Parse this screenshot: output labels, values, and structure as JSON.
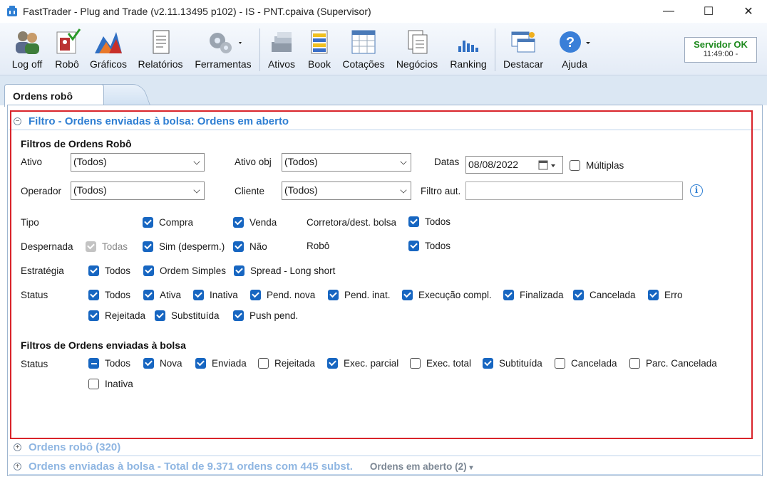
{
  "window": {
    "title": "FastTrader - Plug and Trade (v2.11.13495 p102) - IS - PNT.cpaiva (Supervisor)",
    "minimize": "—",
    "maximize": "☐",
    "close": "✕"
  },
  "toolbar": {
    "items": [
      {
        "label": "Log off",
        "icon": "users-icon"
      },
      {
        "label": "Robô",
        "icon": "robot-icon"
      },
      {
        "label": "Gráficos",
        "icon": "chart-icon"
      },
      {
        "label": "Relatórios",
        "icon": "report-icon"
      },
      {
        "label": "Ferramentas",
        "icon": "gears-icon"
      },
      {
        "label": "Ativos",
        "icon": "assets-icon"
      },
      {
        "label": "Book",
        "icon": "book-icon"
      },
      {
        "label": "Cotações",
        "icon": "quotes-icon"
      },
      {
        "label": "Negócios",
        "icon": "trades-icon"
      },
      {
        "label": "Ranking",
        "icon": "ranking-icon"
      },
      {
        "label": "Destacar",
        "icon": "detach-icon"
      },
      {
        "label": "Ajuda",
        "icon": "help-icon"
      }
    ],
    "server_status": "Servidor OK",
    "server_time": "11:49:00 -"
  },
  "tabs": {
    "active": "Ordens robô"
  },
  "filter_section": {
    "title": "Filtro - Ordens enviadas à bolsa: Ordens em aberto",
    "robot_heading": "Filtros de Ordens Robô",
    "ativo_label": "Ativo",
    "ativo_value": "(Todos)",
    "ativo_obj_label": "Ativo obj",
    "ativo_obj_value": "(Todos)",
    "datas_label": "Datas",
    "datas_value": "08/08/2022",
    "multiplas_label": "Múltiplas",
    "operador_label": "Operador",
    "operador_value": "(Todos)",
    "cliente_label": "Cliente",
    "cliente_value": "(Todos)",
    "filtro_aut_label": "Filtro aut.",
    "filtro_aut_value": "",
    "tipo_label": "Tipo",
    "tipo_compra": "Compra",
    "tipo_venda": "Venda",
    "corretora_label": "Corretora/dest. bolsa",
    "corretora_todos": "Todos",
    "despernada_label": "Despernada",
    "desp_todas": "Todas",
    "desp_sim": "Sim (desperm.)",
    "desp_nao": "Não",
    "robo_label": "Robô",
    "robo_todos": "Todos",
    "estrategia_label": "Estratégia",
    "estr_todos": "Todos",
    "estr_simples": "Ordem Simples",
    "estr_spread": "Spread - Long short",
    "status_label": "Status",
    "status_robot": [
      "Todos",
      "Ativa",
      "Inativa",
      "Pend. nova",
      "Pend. inat.",
      "Execução compl.",
      "Finalizada",
      "Cancelada",
      "Erro",
      "Rejeitada",
      "Substituída",
      "Push pend."
    ],
    "bolsa_heading": "Filtros de Ordens enviadas à bolsa",
    "bolsa_status_label": "Status",
    "status_bolsa": [
      "Todos",
      "Nova",
      "Enviada",
      "Rejeitada",
      "Exec. parcial",
      "Exec. total",
      "Subtituída",
      "Cancelada",
      "Parc. Cancelada",
      "Inativa"
    ]
  },
  "robot_orders_section": {
    "title": "Ordens robô (320)"
  },
  "sent_orders_section": {
    "title": "Ordens enviadas à bolsa - Total de 9.371 ordens com 445 subst.",
    "dropdown": "Ordens em aberto (2)"
  }
}
